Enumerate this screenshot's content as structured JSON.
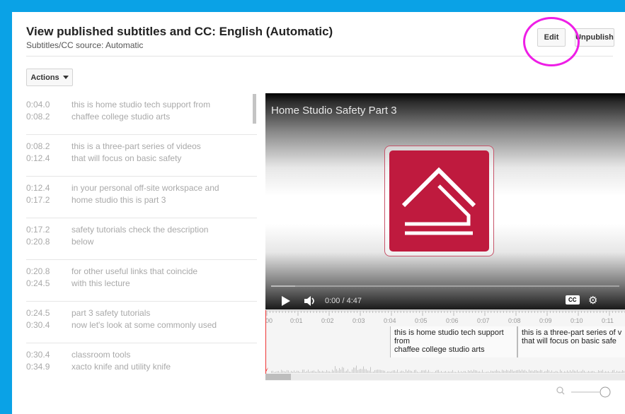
{
  "header": {
    "title": "View published subtitles and CC: English (Automatic)",
    "source": "Subtitles/CC source: Automatic",
    "edit_label": "Edit",
    "unpublish_label": "Unpublish"
  },
  "actions_label": "Actions",
  "subtitles": [
    {
      "start": "0:04.0",
      "end": "0:08.2",
      "line1": "this is home studio tech support from",
      "line2": "chaffee college studio arts"
    },
    {
      "start": "0:08.2",
      "end": "0:12.4",
      "line1": "this is a three-part series of videos",
      "line2": "that will focus on basic safety"
    },
    {
      "start": "0:12.4",
      "end": "0:17.2",
      "line1": "in your personal off-site workspace and",
      "line2": "home studio this is part 3"
    },
    {
      "start": "0:17.2",
      "end": "0:20.8",
      "line1": "safety tutorials check the description",
      "line2": "below"
    },
    {
      "start": "0:20.8",
      "end": "0:24.5",
      "line1": "for other useful links that coincide",
      "line2": "with this lecture"
    },
    {
      "start": "0:24.5",
      "end": "0:30.4",
      "line1": "part 3 safety tutorials",
      "line2": "now let's look at some commonly used"
    },
    {
      "start": "0:30.4",
      "end": "0:34.9",
      "line1": "classroom tools",
      "line2": "xacto knife and utility knife"
    }
  ],
  "video": {
    "title": "Home Studio Safety Part 3",
    "time": "0:00 / 4:47",
    "cc_label": "CC",
    "progress_fraction": 0.07
  },
  "timeline": {
    "ticks": [
      "00",
      "0:01",
      "0:02",
      "0:03",
      "0:04",
      "0:05",
      "0:06",
      "0:07",
      "0:08",
      "0:09",
      "0:10",
      "0:11"
    ],
    "cap1": {
      "l1": "this is home studio tech support",
      "l2": "from",
      "l3": "chaffee college studio arts"
    },
    "cap2": {
      "l1": "this is a three-part series of v",
      "l2": "that will focus on basic safe"
    }
  },
  "colors": {
    "frame": "#0aa2e6",
    "annotation": "#ee1ee6",
    "logo": "#bf1a3e"
  }
}
